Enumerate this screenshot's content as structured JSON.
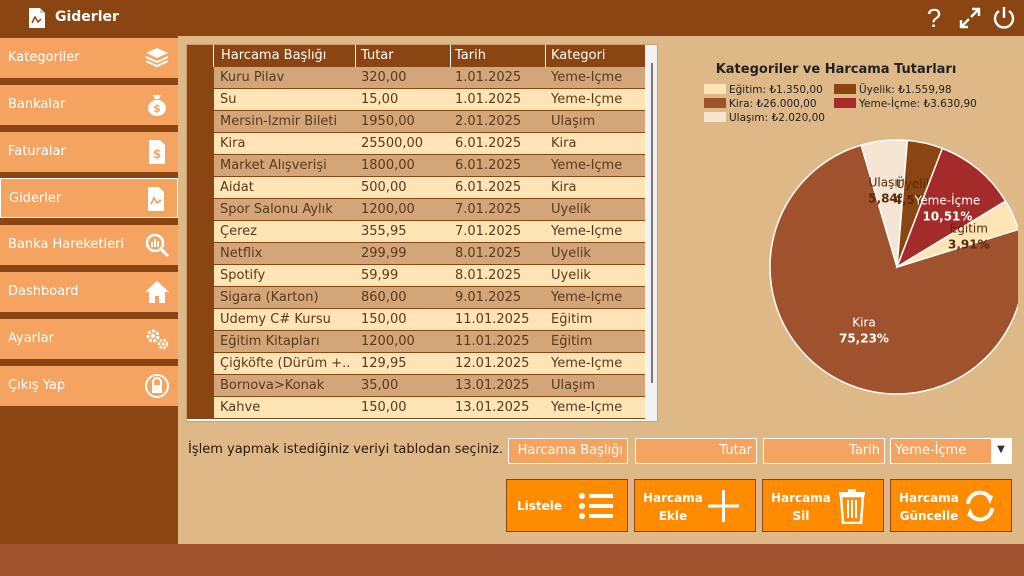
{
  "window": {
    "title": "Giderler"
  },
  "sidebar": {
    "items": [
      {
        "label": "Kategoriler",
        "icon": "layers-icon"
      },
      {
        "label": "Bankalar",
        "icon": "money-bag-icon"
      },
      {
        "label": "Faturalar",
        "icon": "invoice-icon"
      },
      {
        "label": "Giderler",
        "icon": "document-icon"
      },
      {
        "label": "Banka Hareketleri",
        "icon": "chart-search-icon"
      },
      {
        "label": "Dashboard",
        "icon": "home-icon"
      },
      {
        "label": "Ayarlar",
        "icon": "gears-icon"
      },
      {
        "label": "Çıkış Yap",
        "icon": "lock-icon"
      }
    ]
  },
  "table": {
    "columns": [
      "Harcama Başlığı",
      "Tutar",
      "Tarih",
      "Kategori"
    ],
    "rows": [
      [
        "Kuru Pilav",
        "320,00",
        "1.01.2025",
        "Yeme-İçme"
      ],
      [
        "Su",
        "15,00",
        "1.01.2025",
        "Yeme-İçme"
      ],
      [
        "Mersin-İzmir Bileti",
        "1950,00",
        "2.01.2025",
        "Ulaşım"
      ],
      [
        "Kira",
        "25500,00",
        "6.01.2025",
        "Kira"
      ],
      [
        "Market Alışverişi",
        "1800,00",
        "6.01.2025",
        "Yeme-İçme"
      ],
      [
        "Aidat",
        "500,00",
        "6.01.2025",
        "Kira"
      ],
      [
        "Spor Salonu Aylık",
        "1200,00",
        "7.01.2025",
        "Üyelik"
      ],
      [
        "Çerez",
        "355,95",
        "7.01.2025",
        "Yeme-İçme"
      ],
      [
        "Netflix",
        "299,99",
        "8.01.2025",
        "Üyelik"
      ],
      [
        "Spotify",
        "59,99",
        "8.01.2025",
        "Üyelik"
      ],
      [
        "Sigara (Karton)",
        "860,00",
        "9.01.2025",
        "Yeme-İçme"
      ],
      [
        "Udemy C# Kursu",
        "150,00",
        "11.01.2025",
        "Eğitim"
      ],
      [
        "Eğitim Kitapları",
        "1200,00",
        "11.01.2025",
        "Eğitim"
      ],
      [
        "Çiğköfte (Dürüm +...",
        "129,95",
        "12.01.2025",
        "Yeme-İçme"
      ],
      [
        "Bornova>Konak",
        "35,00",
        "13.01.2025",
        "Ulaşım"
      ],
      [
        "Kahve",
        "150,00",
        "13.01.2025",
        "Yeme-İçme"
      ]
    ]
  },
  "form": {
    "hint": "İşlem yapmak istediğiniz veriyi tablodan seçiniz.",
    "title_placeholder": "Harcama Başlığı",
    "amount_placeholder": "Tutar",
    "date_placeholder": "Tarih",
    "category_selected": "Yeme-İçme"
  },
  "actions": {
    "list": "Listele",
    "add_line1": "Harcama",
    "add_line2": "Ekle",
    "delete_line1": "Harcama",
    "delete_line2": "Sil",
    "update_line1": "Harcama",
    "update_line2": "Güncelle"
  },
  "colors": {
    "egitim": "#FFE4B5",
    "kira": "#A0522D",
    "ulasim": "#F5E6D3",
    "uyelik": "#8B4513",
    "yeme_icme": "#A52A2A"
  },
  "chart_data": {
    "type": "pie",
    "title": "Kategoriler ve Harcama Tutarları",
    "legend": [
      "Eğitim: ₺1.350,00",
      "Üyelik: ₺1.559,98",
      "Kira: ₺26.000,00",
      "Yeme-İçme: ₺3.630,90",
      "Ulaşım: ₺2.020,00"
    ],
    "slices": [
      {
        "name": "Kira",
        "value": 26000.0,
        "percent_label": "75,23%"
      },
      {
        "name": "Ulaşım",
        "value": 2020.0,
        "percent_label": "5,84%"
      },
      {
        "name": "Üyelik",
        "value": 1559.98,
        "percent_label": "4,51%"
      },
      {
        "name": "Yeme-İçme",
        "value": 3630.9,
        "percent_label": "10,51%"
      },
      {
        "name": "Eğitim",
        "value": 1350.0,
        "percent_label": "3,91%"
      }
    ]
  }
}
